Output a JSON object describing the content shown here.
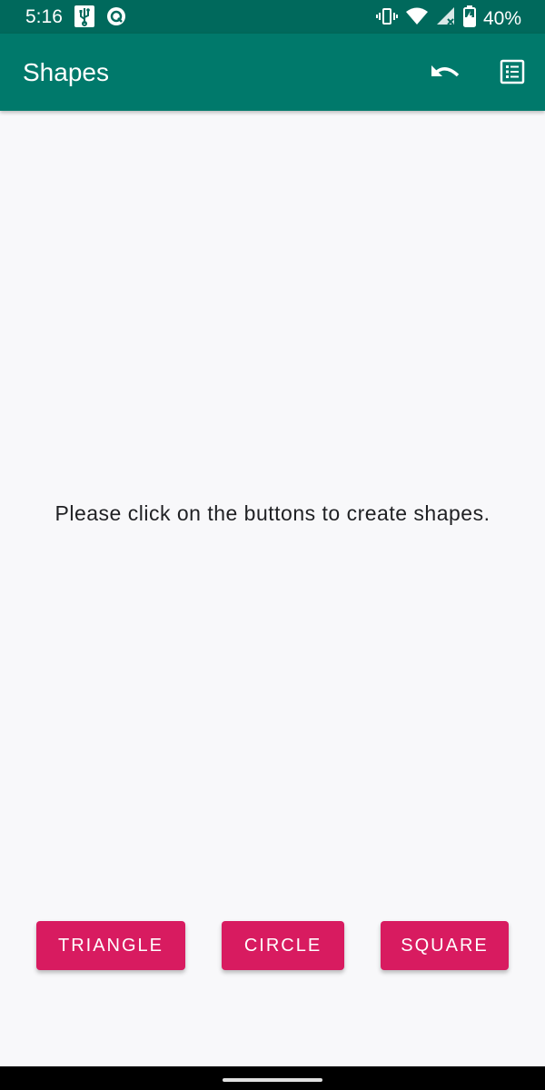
{
  "status_bar": {
    "time": "5:16",
    "battery": "40%",
    "icons": [
      "usb-icon",
      "at-sign-icon",
      "vibrate-icon",
      "wifi-icon",
      "cellular-icon",
      "battery-icon"
    ],
    "color": "#00695c"
  },
  "app_bar": {
    "title": "Shapes",
    "color": "#00796b",
    "actions": [
      "undo-icon",
      "list-icon"
    ]
  },
  "main": {
    "message": "Please click on the buttons to create shapes."
  },
  "buttons": {
    "triangle_label": "TRIANGLE",
    "circle_label": "CIRCLE",
    "square_label": "SQUARE",
    "color": "#d81b60"
  }
}
